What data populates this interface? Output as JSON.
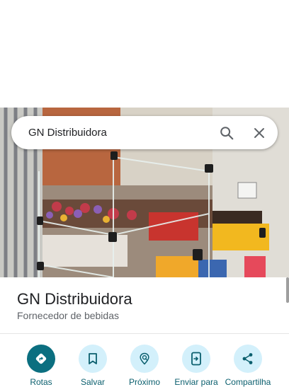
{
  "search": {
    "query": "GN Distribuidora"
  },
  "place": {
    "name": "GN Distribuidora",
    "category": "Fornecedor de bebidas"
  },
  "actions": [
    {
      "label": "Rotas",
      "icon": "directions-icon"
    },
    {
      "label": "Salvar",
      "icon": "bookmark-icon"
    },
    {
      "label": "Próximo",
      "icon": "nearby-icon"
    },
    {
      "label": "Enviar para",
      "icon": "send-to-phone-icon"
    },
    {
      "label": "Compartilha",
      "icon": "share-icon"
    }
  ],
  "colors": {
    "primary": "#0b6f80",
    "action_bg": "#d3f0fb",
    "label": "#0b5f6e"
  }
}
